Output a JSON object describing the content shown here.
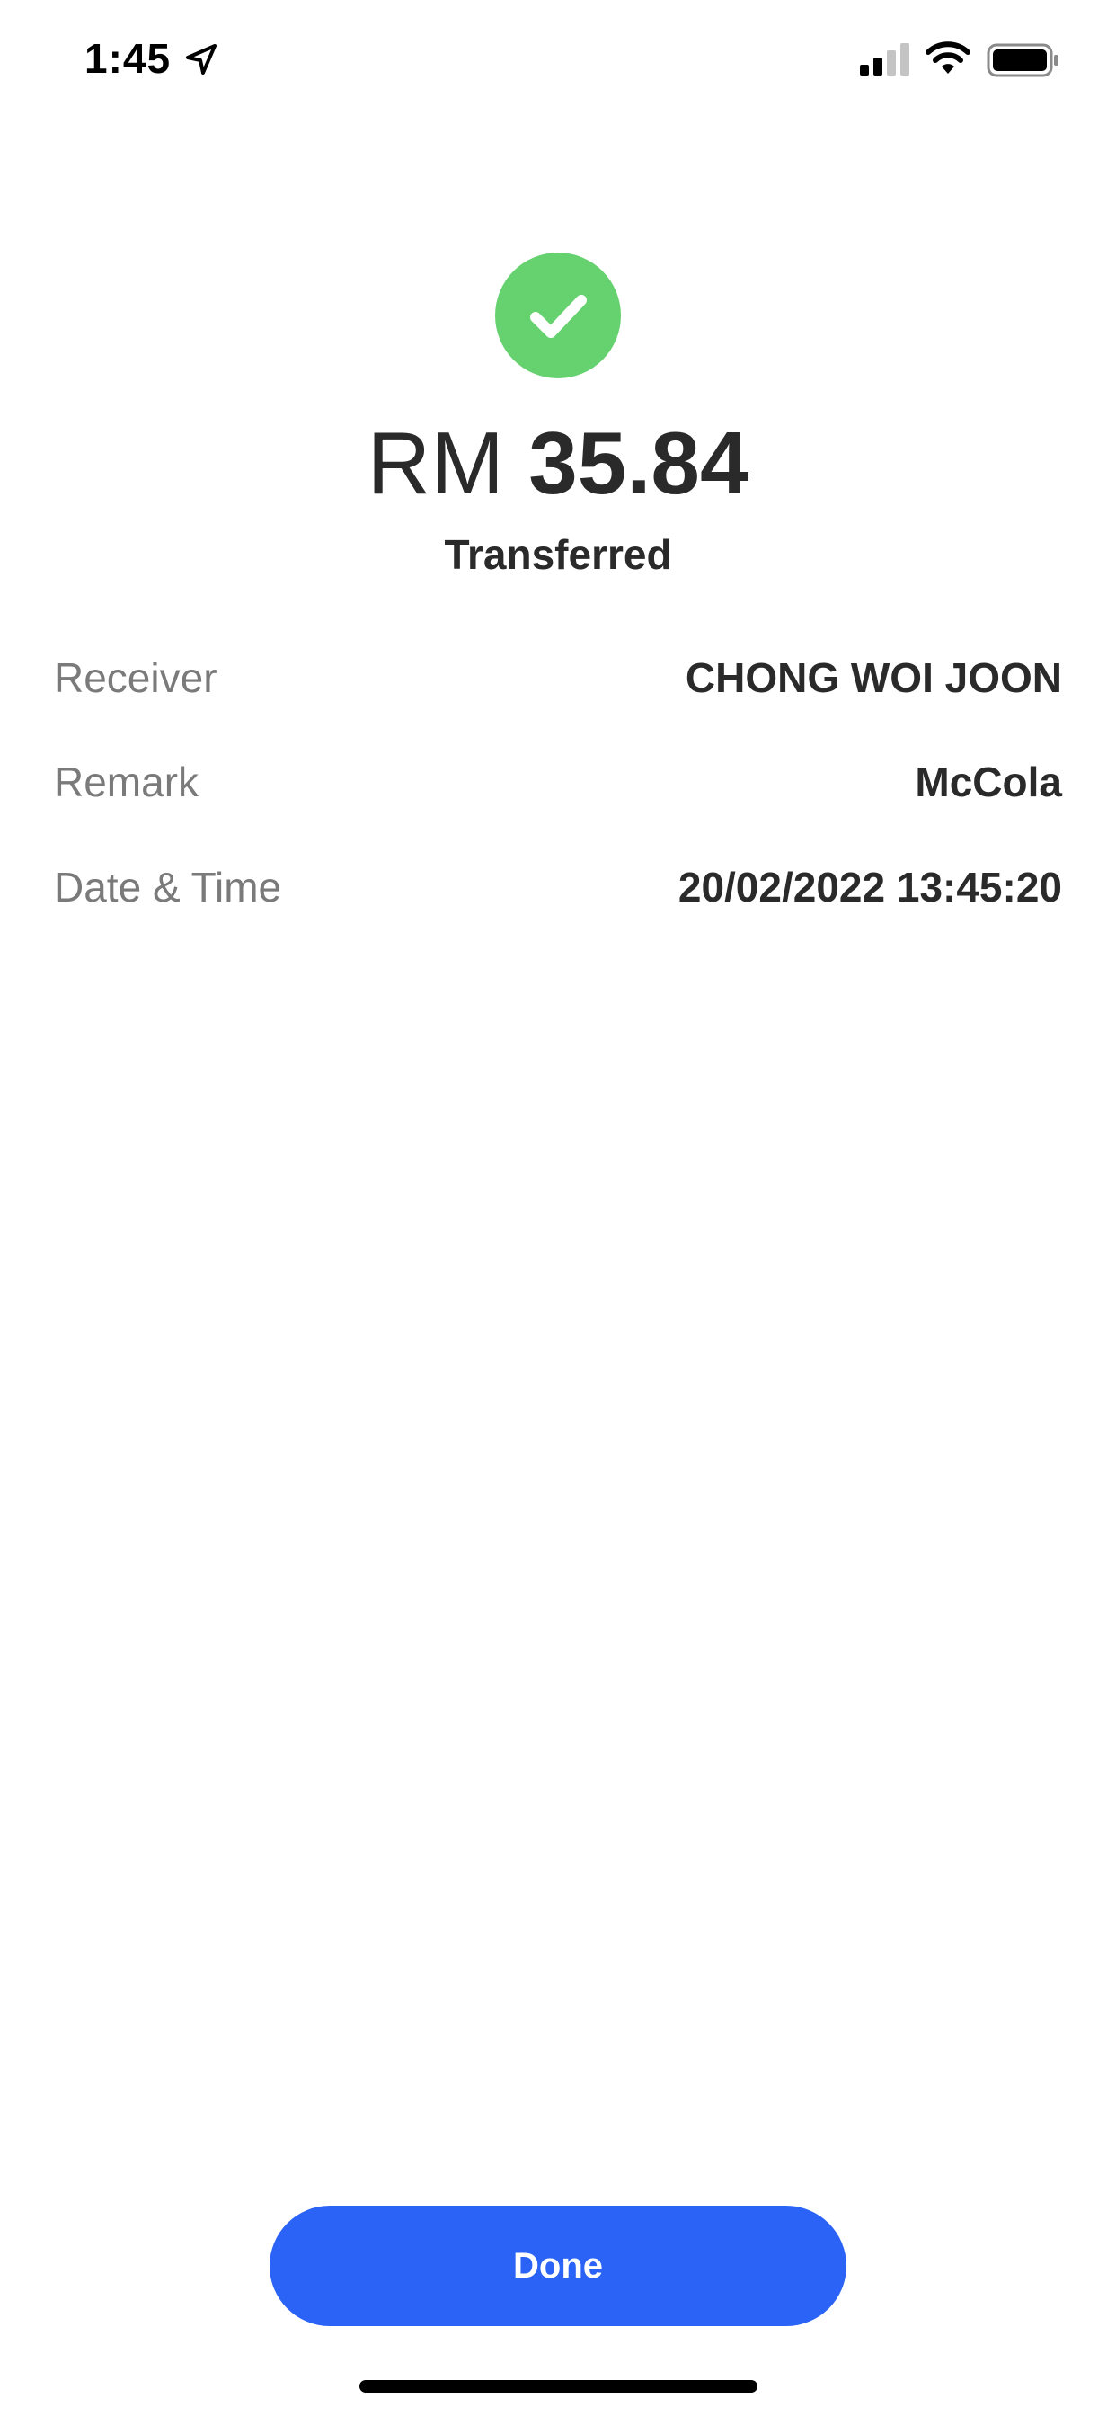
{
  "status_bar": {
    "time": "1:45",
    "icons": [
      "location-arrow-icon",
      "cellular-signal-icon",
      "wifi-icon",
      "battery-icon"
    ]
  },
  "receipt": {
    "icon": "check-circle-icon",
    "success_color": "#66d26f",
    "currency": "RM",
    "amount": "35.84",
    "status": "Transferred",
    "details": [
      {
        "label": "Receiver",
        "value": "CHONG WOI JOON"
      },
      {
        "label": "Remark",
        "value": "McCola"
      },
      {
        "label": "Date & Time",
        "value": "20/02/2022 13:45:20"
      }
    ]
  },
  "actions": {
    "done_label": "Done",
    "accent_color": "#2a63f6"
  }
}
